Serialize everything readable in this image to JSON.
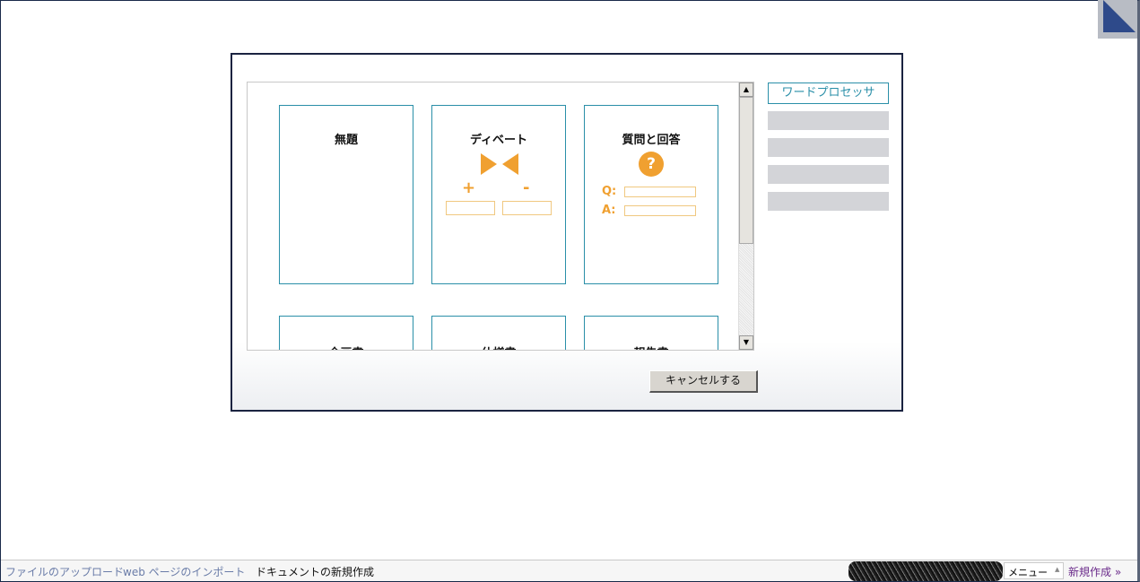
{
  "templates": [
    {
      "title": "無題"
    },
    {
      "title": "ディベート",
      "plus": "+",
      "minus": "-"
    },
    {
      "title": "質問と回答",
      "q_label": "Q:",
      "a_label": "A:",
      "icon": "?"
    },
    {
      "title": "企画書"
    },
    {
      "title": "仕様書"
    },
    {
      "title": "報告書"
    }
  ],
  "categories": [
    {
      "label": "ワードプロセッサ"
    }
  ],
  "cancel_label": "キャンセルする",
  "footer": {
    "upload": "ファイルのアップロード",
    "import": "web ページのインポート",
    "new_doc": "ドキュメントの新規作成",
    "menu": "メニュー",
    "create": "新規作成 »"
  },
  "colors": {
    "accent": "#2a8fa8",
    "orange": "#f0a030",
    "border": "#1a2340"
  }
}
